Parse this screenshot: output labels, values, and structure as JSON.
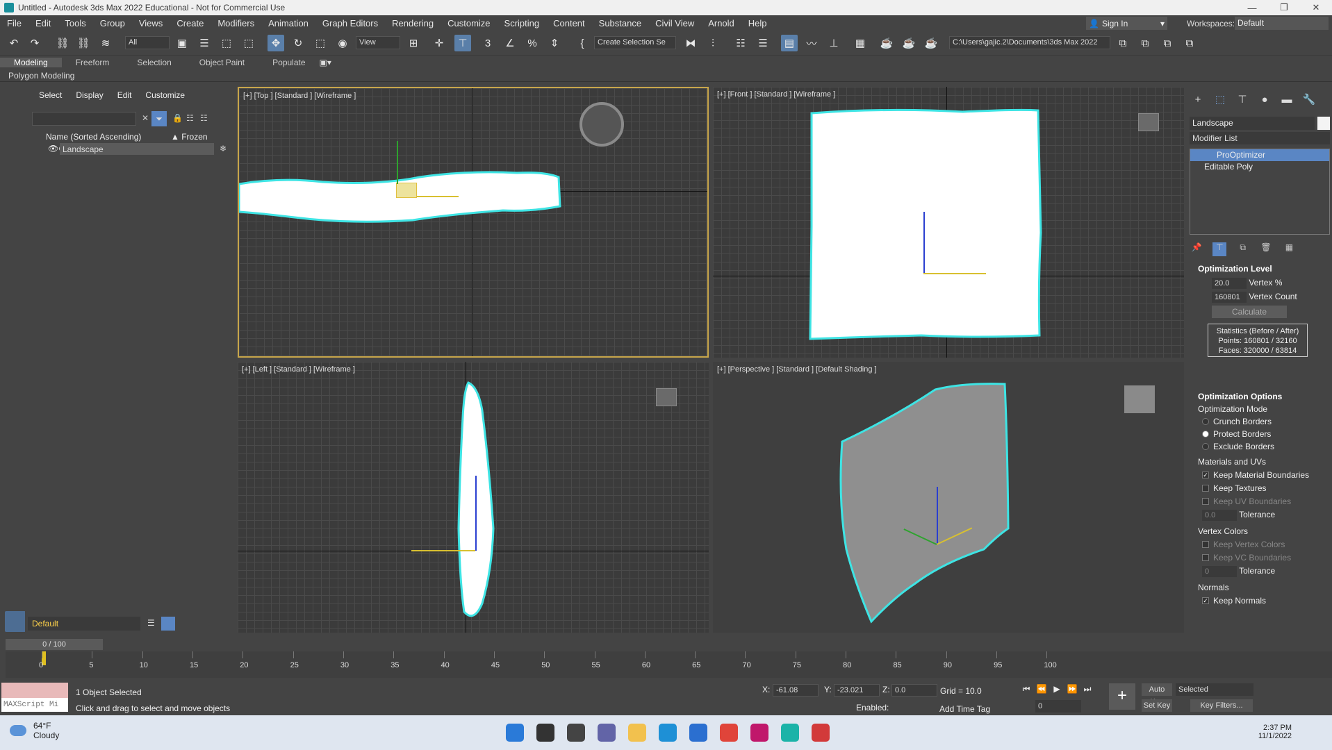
{
  "window": {
    "title": "Untitled - Autodesk 3ds Max 2022 Educational - Not for Commercial Use"
  },
  "menu": [
    "File",
    "Edit",
    "Tools",
    "Group",
    "Views",
    "Create",
    "Modifiers",
    "Animation",
    "Graph Editors",
    "Rendering",
    "Customize",
    "Scripting",
    "Content",
    "Substance",
    "Civil View",
    "Arnold",
    "Help"
  ],
  "account": {
    "sign_in": "Sign In",
    "workspaces_label": "Workspaces:",
    "workspace": "Default"
  },
  "toolbar": {
    "filter": "All",
    "ref_coord": "View",
    "selection_set": "Create Selection Se",
    "project_path": "C:\\Users\\gajic.2\\Documents\\3ds Max 2022"
  },
  "ribbon": {
    "tabs": [
      "Modeling",
      "Freeform",
      "Selection",
      "Object Paint",
      "Populate"
    ],
    "panel": "Polygon Modeling"
  },
  "scene_explorer": {
    "tabs": [
      "Select",
      "Display",
      "Edit",
      "Customize"
    ],
    "column_name": "Name (Sorted Ascending)",
    "column_frozen": "▲ Frozen",
    "items": [
      {
        "name": "Landscape"
      }
    ],
    "layer": "Default"
  },
  "viewports": {
    "top": "[+] [Top ] [Standard ] [Wireframe ]",
    "front": "[+] [Front ] [Standard ] [Wireframe ]",
    "left": "[+] [Left ] [Standard ] [Wireframe ]",
    "perspective": "[+] [Perspective ] [Standard ] [Default Shading ]"
  },
  "command_panel": {
    "object_name": "Landscape",
    "modifier_list": "Modifier List",
    "stack": [
      "ProOptimizer",
      "Editable Poly"
    ],
    "optimization_level": {
      "title": "Optimization Level",
      "vertex_pct": "20.0",
      "vertex_pct_label": "Vertex %",
      "vertex_count": "160801",
      "vertex_count_label": "Vertex Count",
      "calculate": "Calculate",
      "stats_title": "Statistics (Before / After)",
      "points": "Points: 160801 / 32160",
      "faces": "Faces: 320000 / 63814"
    },
    "optimization_options": {
      "title": "Optimization Options",
      "mode_label": "Optimization Mode",
      "modes": [
        "Crunch Borders",
        "Protect Borders",
        "Exclude Borders"
      ],
      "materials_label": "Materials and UVs",
      "keep_material_boundaries": "Keep Material Boundaries",
      "keep_textures": "Keep Textures",
      "keep_uv_boundaries": "Keep UV Boundaries",
      "tolerance_value": "0.0",
      "tolerance_label": "Tolerance",
      "vertex_colors_label": "Vertex Colors",
      "keep_vertex_colors": "Keep Vertex Colors",
      "keep_vc_boundaries": "Keep VC Boundaries",
      "vc_tolerance_value": "0",
      "vc_tolerance_label": "Tolerance",
      "normals_label": "Normals",
      "keep_normals": "Keep Normals"
    }
  },
  "timeline": {
    "frame_display": "0 / 100",
    "ticks": [
      "0",
      "5",
      "10",
      "15",
      "20",
      "25",
      "30",
      "35",
      "40",
      "45",
      "50",
      "55",
      "60",
      "65",
      "70",
      "75",
      "80",
      "85",
      "90",
      "95",
      "100"
    ]
  },
  "status": {
    "maxscript": "MAXScript Mi",
    "selection": "1 Object Selected",
    "prompt": "Click and drag to select and move objects",
    "x_label": "X:",
    "x": "-61.08",
    "y_label": "Y:",
    "y": "-23.021",
    "z_label": "Z:",
    "z": "0.0",
    "grid": "Grid = 10.0",
    "enabled": "Enabled:",
    "add_time_tag": "Add Time Tag",
    "auto_key": "Auto Key",
    "set_key": "Set Key",
    "selected": "Selected",
    "key_filters": "Key Filters...",
    "current_frame": "0"
  },
  "taskbar": {
    "temp": "64°F",
    "weather": "Cloudy",
    "time": "2:37 PM",
    "date": "11/1/2022"
  }
}
